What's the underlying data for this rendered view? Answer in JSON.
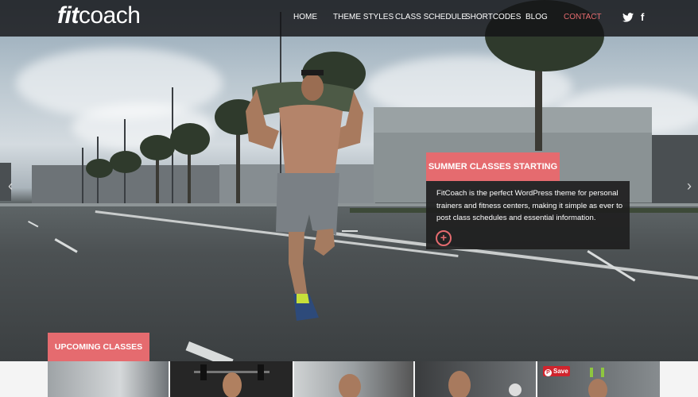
{
  "header": {
    "logo_bold": "fit",
    "logo_light": "coach",
    "nav": [
      "HOME",
      "THEME STYLES",
      "CLASS SCHEDULE",
      "SHORTCODES",
      "BLOG",
      "CONTACT"
    ],
    "active_item": "CONTACT",
    "social": [
      "twitter-icon",
      "facebook-icon"
    ],
    "social_glyphs": {
      "twitter": "🐦",
      "facebook": "f"
    }
  },
  "slider": {
    "prev_glyph": "‹",
    "next_glyph": "›",
    "caption_title": "SUMMER CLASSES STARTING",
    "caption_text": "FitCoach is the perfect WordPress theme for personal trainers and fitness centers, making it simple as ever to post class schedules and essential information.",
    "more_glyph": "+"
  },
  "classes": {
    "label": "UPCOMING CLASSES",
    "save_label": "Save",
    "save_glyph": "P"
  },
  "colors": {
    "accent": "#e56b6f",
    "nav_bg": "#141416",
    "save_red": "#d0242d"
  }
}
